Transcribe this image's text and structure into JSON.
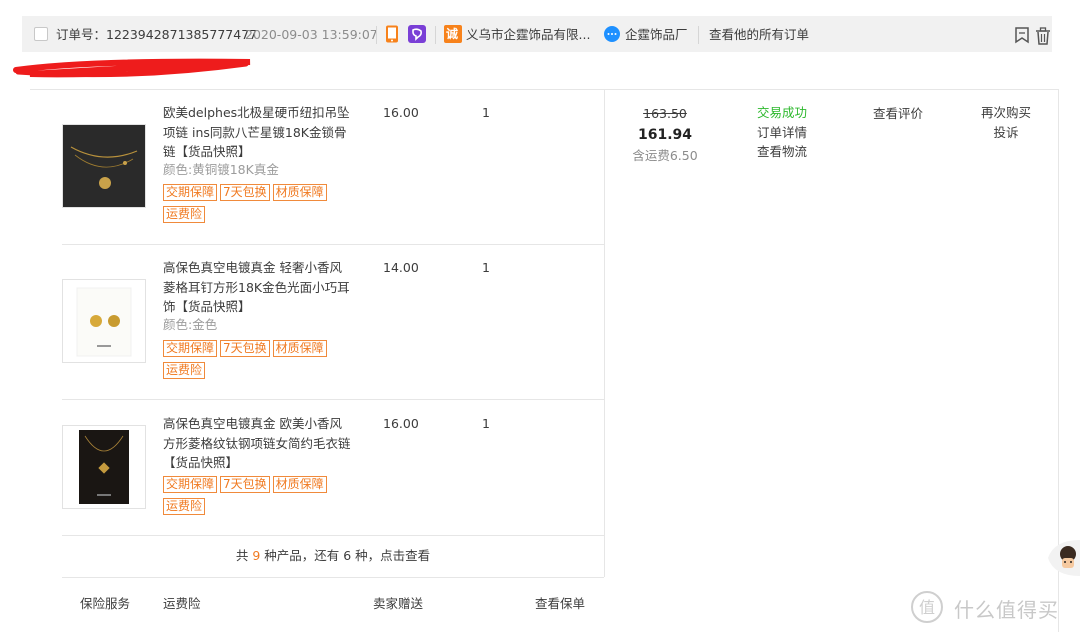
{
  "header": {
    "order_no_label": "订单号：",
    "order_no": "1223942871385777477",
    "datetime": "2020-09-03 13:59:07",
    "shop_badge": "诚",
    "shop_name": "义乌市企霆饰品有限...",
    "seller_name": "企霆饰品厂",
    "all_orders_link": "查看他的所有订单"
  },
  "items": [
    {
      "title": "欧美delphes北极星硬币纽扣吊坠项链 ins同款八芒星镀18K金锁骨链",
      "snapshot": "【货品快照】",
      "sku": "颜色:黄铜镀18K真金",
      "price": "16.00",
      "qty": "1",
      "tags": [
        "交期保障",
        "7天包换",
        "材质保障",
        "运费险"
      ]
    },
    {
      "title": "高保色真空电镀真金 轻奢小香风菱格耳钉方形18K金色光面小巧耳饰",
      "snapshot": "【货品快照】",
      "sku": "颜色:金色",
      "price": "14.00",
      "qty": "1",
      "tags": [
        "交期保障",
        "7天包换",
        "材质保障",
        "运费险"
      ]
    },
    {
      "title": "高保色真空电镀真金 欧美小香风方形菱格纹钛钢项链女简约毛衣链",
      "snapshot": "【货品快照】",
      "sku": "",
      "price": "16.00",
      "qty": "1",
      "tags": [
        "交期保障",
        "7天包换",
        "材质保障",
        "运费险"
      ]
    }
  ],
  "totals": {
    "original": "163.50",
    "paid": "161.94",
    "shipping_note": "含运费6.50"
  },
  "status": {
    "state": "交易成功",
    "detail_link": "订单详情",
    "logistics_link": "查看物流"
  },
  "review_link": "查看评价",
  "actions": {
    "rebuy": "再次购买",
    "complaint": "投诉"
  },
  "more": {
    "prefix": "共 ",
    "count": "9",
    "middle": " 种产品，还有 ",
    "rest": "6",
    "suffix": " 种，点击查看"
  },
  "insurance": {
    "label": "保险服务",
    "name": "运费险",
    "giver": "卖家赠送",
    "view_policy": "查看保单"
  },
  "watermark": "什么值得买",
  "colors": {
    "accent": "#f07a21",
    "success": "#2db82d",
    "redaction": "#ee1c1c"
  }
}
